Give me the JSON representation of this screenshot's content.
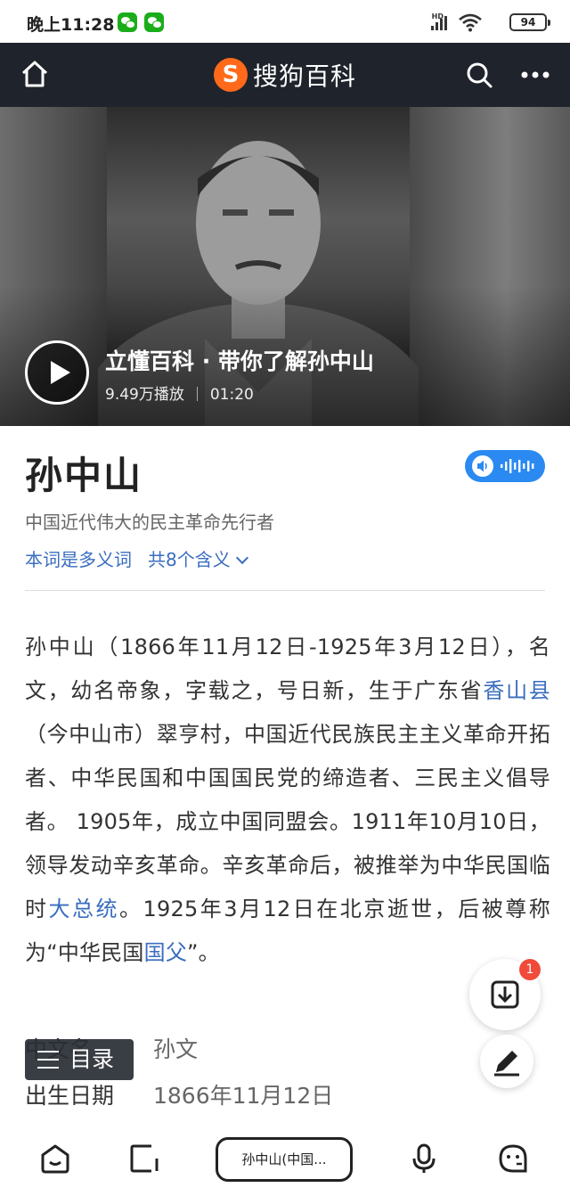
{
  "status_bar": {
    "time": "晚上11:28",
    "network": "HD",
    "battery": "94"
  },
  "header": {
    "brand_name": "搜狗百科",
    "logo_letter": "S"
  },
  "video": {
    "title": "立懂百科 · 带你了解孙中山",
    "plays": "9.49万播放",
    "duration": "01:20"
  },
  "entry": {
    "title": "孙中山",
    "subtitle": "中国近代伟大的民主革命先行者",
    "polysemy_label": "本词是多义词",
    "meanings_count": "共8个含义"
  },
  "summary": {
    "p1": "孙中山（1866年11月12日-1925年3月12日），名文，幼名帝象，字载之，号日新，生于广东省",
    "link1": "香山县",
    "p2": "（今中山市）翠亨村，中国近代民族民主主义革命开拓者、中华民国和中国国民党的缔造者、三民主义倡导者。 1905年，成立中国同盟会。1911年10月10日，领导发动辛亥革命。辛亥革命后，被推举为中华民国临时",
    "link2": "大总统",
    "p3": "。1925年3月12日在北京逝世，后被尊称为“中华民国",
    "link3": "国父",
    "p4": "”。"
  },
  "info_table": [
    {
      "key": "中文名",
      "value": "孙文"
    },
    {
      "key": "出生日期",
      "value": "1866年11月12日"
    }
  ],
  "toc_label": "目录",
  "fab": {
    "download_badge": "1"
  },
  "bottom_bar": {
    "tab_label": "孙中山(中国..."
  },
  "colors": {
    "link": "#3a6dbf",
    "header_bg": "#1f232b",
    "brand_orange": "#ff6a1a",
    "audio_blue": "#2b8af2",
    "badge_red": "#f04a3a"
  }
}
